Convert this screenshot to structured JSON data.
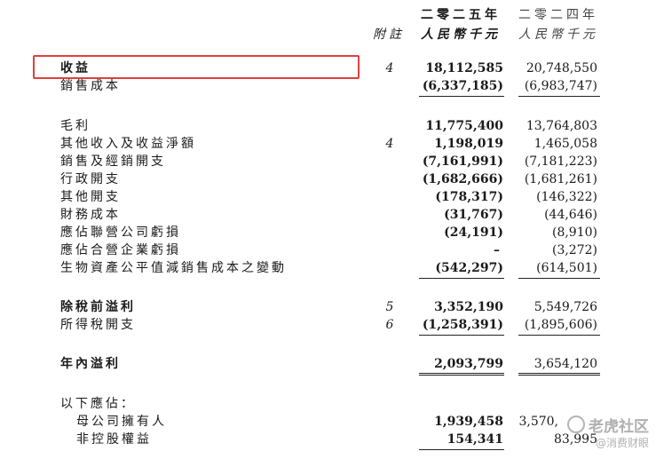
{
  "header": {
    "note_label": "附註",
    "year_2025": "二零二五年",
    "year_2024": "二零二四年",
    "unit_2025": "人民幣千元",
    "unit_2024": "人民幣千元"
  },
  "rows": {
    "revenue": {
      "label": "收益",
      "note": "4",
      "v2025": "18,112,585",
      "v2024": "20,748,550"
    },
    "cost_of_sales": {
      "label": "銷售成本",
      "note": "",
      "v2025": "(6,337,185)",
      "v2024": "(6,983,747)"
    },
    "gross_profit": {
      "label": "毛利",
      "note": "",
      "v2025": "11,775,400",
      "v2024": "13,764,803"
    },
    "other_income": {
      "label": "其他收入及收益淨額",
      "note": "4",
      "v2025": "1,198,019",
      "v2024": "1,465,058"
    },
    "selling": {
      "label": "銷售及經銷開支",
      "note": "",
      "v2025": "(7,161,991)",
      "v2024": "(7,181,223)"
    },
    "admin": {
      "label": "行政開支",
      "note": "",
      "v2025": "(1,682,666)",
      "v2024": "(1,681,261)"
    },
    "other_exp": {
      "label": "其他開支",
      "note": "",
      "v2025": "(178,317)",
      "v2024": "(146,322)"
    },
    "finance": {
      "label": "財務成本",
      "note": "",
      "v2025": "(31,767)",
      "v2024": "(44,646)"
    },
    "share_assoc": {
      "label": "應佔聯營公司虧損",
      "note": "",
      "v2025": "(24,191)",
      "v2024": "(8,910)"
    },
    "share_jv": {
      "label": "應佔合營企業虧損",
      "note": "",
      "v2025": "–",
      "v2024": "(3,272)"
    },
    "bio_assets": {
      "label": "生物資產公平值減銷售成本之變動",
      "note": "",
      "v2025": "(542,297)",
      "v2024": "(614,501)"
    },
    "pbt": {
      "label": "除稅前溢利",
      "note": "5",
      "v2025": "3,352,190",
      "v2024": "5,549,726"
    },
    "tax": {
      "label": "所得稅開支",
      "note": "6",
      "v2025": "(1,258,391)",
      "v2024": "(1,895,606)"
    },
    "profit": {
      "label": "年內溢利",
      "note": "",
      "v2025": "2,093,799",
      "v2024": "3,654,120"
    },
    "attrib": {
      "label": "以下應佔："
    },
    "owners": {
      "label": "母公司擁有人",
      "v2025": "1,939,458",
      "v2024": "3,570,"
    },
    "nci": {
      "label": "非控股權益",
      "v2025": "154,341",
      "v2024": "83,995"
    }
  },
  "watermark": {
    "line1": "老虎社区",
    "line2": "@消费财眼"
  },
  "highlight_color": "#e0403c"
}
